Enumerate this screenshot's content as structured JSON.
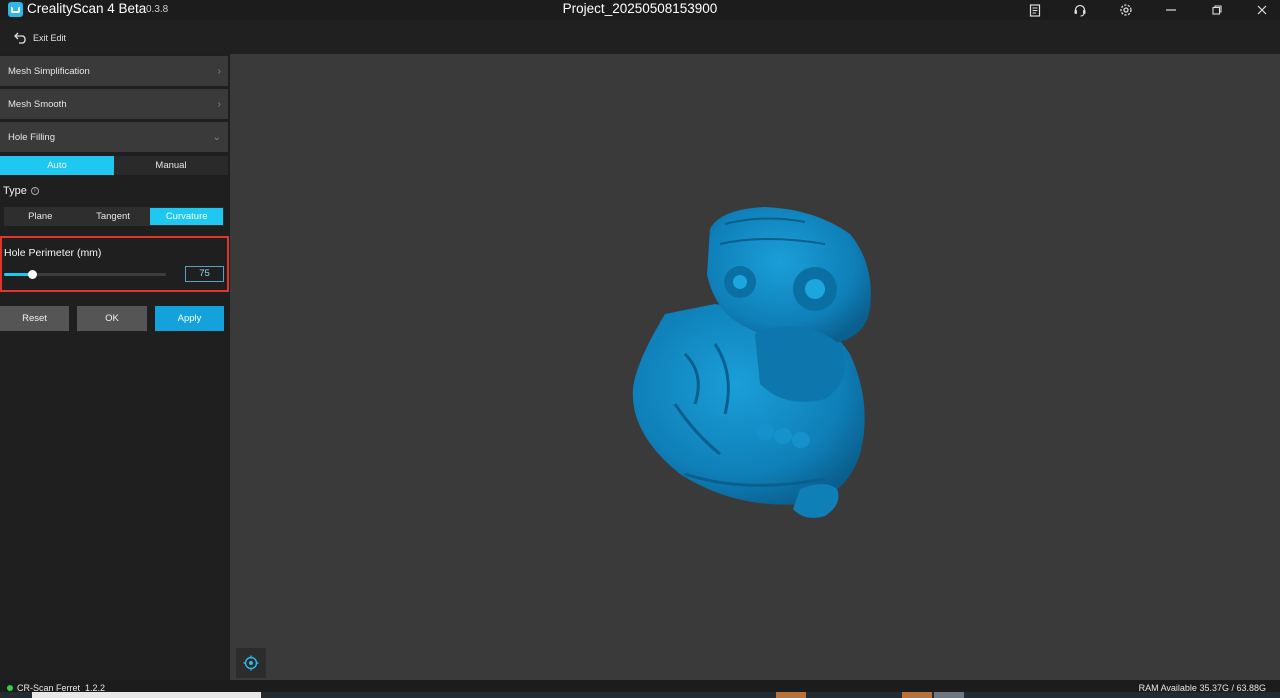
{
  "titlebar": {
    "app_name": "CrealityScan 4 Beta",
    "app_version": "0.3.8",
    "project_title": "Project_20250508153900",
    "icons": [
      "notes-icon",
      "support-headset-icon",
      "settings-gear-icon",
      "minimize-icon",
      "restore-icon",
      "close-icon"
    ]
  },
  "toolbar": {
    "exit_edit_label": "Exit Edit",
    "exit_icon": "undo-arrow-icon"
  },
  "panel": {
    "sections": [
      {
        "label": "Mesh Simplification",
        "state": "collapsed"
      },
      {
        "label": "Mesh Smooth",
        "state": "collapsed"
      },
      {
        "label": "Hole Filling",
        "state": "expanded"
      }
    ],
    "mode_tabs": {
      "auto_label": "Auto",
      "manual_label": "Manual",
      "selected": "Auto"
    },
    "type_label": "Type",
    "type_tabs": {
      "plane_label": "Plane",
      "tangent_label": "Tangent",
      "curvature_label": "Curvature",
      "selected": "Curvature"
    },
    "perimeter": {
      "label": "Hole Perimeter (mm)",
      "value": "75",
      "slider_fraction": 0.17
    },
    "buttons": {
      "reset_label": "Reset",
      "ok_label": "OK",
      "apply_label": "Apply"
    }
  },
  "viewport": {
    "model": "owl-mesh",
    "model_color": "#0f7fb8",
    "background_color": "#3a3a3a"
  },
  "status": {
    "connection_color": "#29d24a",
    "device_name": "CR-Scan Ferret_1.2.2",
    "ram_text": "RAM Available 35.37G / 63.88G"
  },
  "colors": {
    "accent": "#1ec8f0",
    "apply": "#14a2dc",
    "highlight_border": "#e0352b"
  }
}
